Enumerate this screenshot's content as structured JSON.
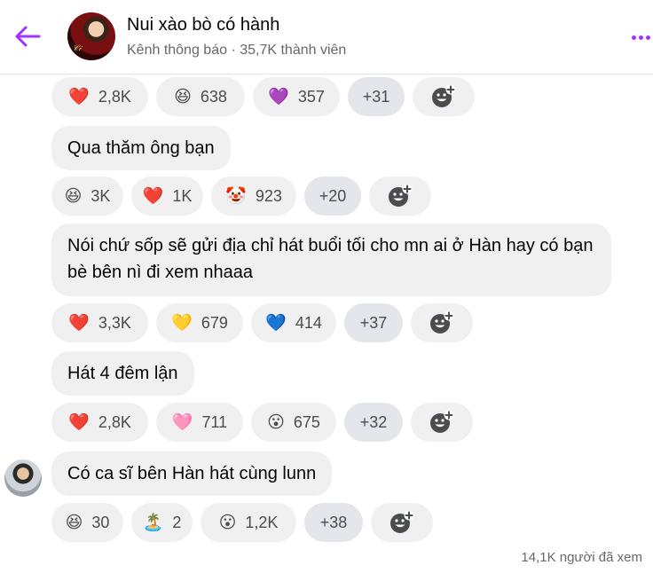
{
  "header": {
    "title": "Nui xào bò có hành",
    "subtitle": "Kênh thông báo · 35,7K thành viên"
  },
  "messages": [
    {
      "text": "",
      "reactions": [
        {
          "icon": "heart-icon",
          "glyph": "❤️",
          "count": "2,8K"
        },
        {
          "icon": "laughing-face-icon",
          "glyph": "😆",
          "count": "638"
        },
        {
          "icon": "purple-heart-icon",
          "glyph": "💜",
          "count": "357"
        }
      ],
      "more": "+31"
    },
    {
      "text": "Qua thăm ông bạn",
      "reactions": [
        {
          "icon": "laughing-face-icon",
          "glyph": "😆",
          "count": "3K"
        },
        {
          "icon": "heart-icon",
          "glyph": "❤️",
          "count": "1K"
        },
        {
          "icon": "clown-face-icon",
          "glyph": "🤡",
          "count": "923"
        }
      ],
      "more": "+20"
    },
    {
      "text": "Nói chứ sốp sẽ gửi địa chỉ hát buổi tối cho mn ai ở Hàn hay có bạn bè bên nì đi xem nhaaa",
      "reactions": [
        {
          "icon": "heart-icon",
          "glyph": "❤️",
          "count": "3,3K"
        },
        {
          "icon": "yellow-heart-icon",
          "glyph": "💛",
          "count": "679"
        },
        {
          "icon": "blue-heart-icon",
          "glyph": "💙",
          "count": "414"
        }
      ],
      "more": "+37"
    },
    {
      "text": "Hát 4 đêm lận",
      "reactions": [
        {
          "icon": "heart-icon",
          "glyph": "❤️",
          "count": "2,8K"
        },
        {
          "icon": "pink-heart-icon",
          "glyph": "🩷",
          "count": "711"
        },
        {
          "icon": "surprised-face-icon",
          "glyph": "😮",
          "count": "675"
        }
      ],
      "more": "+32"
    },
    {
      "text": "Có ca sĩ bên Hàn hát cùng lunn",
      "reactions": [
        {
          "icon": "laughing-face-icon",
          "glyph": "😆",
          "count": "30"
        },
        {
          "icon": "beach-icon",
          "glyph": "🏝️",
          "count": "2"
        },
        {
          "icon": "surprised-face-icon",
          "glyph": "😮",
          "count": "1,2K"
        }
      ],
      "more": "+38"
    }
  ],
  "footer": {
    "views": "14,1K người đã xem"
  },
  "colors": {
    "accent": "#a033ff",
    "bubble": "#f0f0f0",
    "more_pill": "#e4e6eb",
    "secondary_text": "#65676b"
  }
}
